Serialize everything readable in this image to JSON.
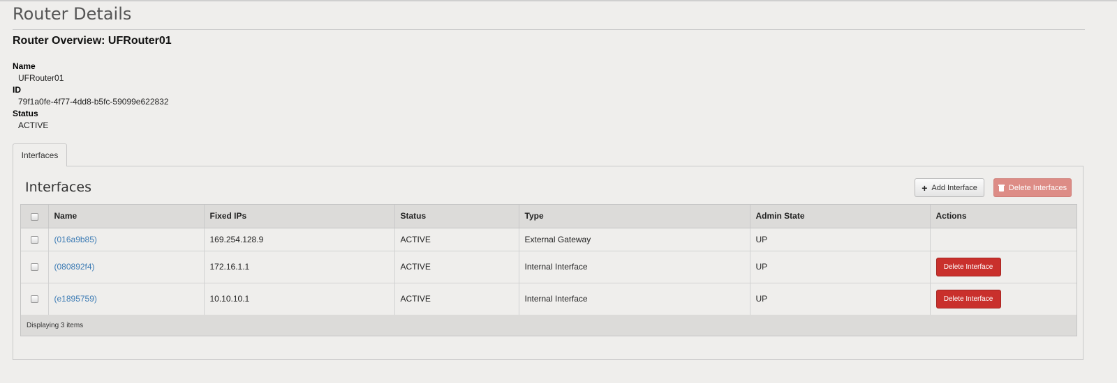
{
  "page": {
    "title": "Router Details"
  },
  "overview": {
    "title": "Router Overview: UFRouter01",
    "fields": [
      {
        "label": "Name",
        "value": "UFRouter01"
      },
      {
        "label": "ID",
        "value": "79f1a0fe-4f77-4dd8-b5fc-59099e622832"
      },
      {
        "label": "Status",
        "value": "ACTIVE"
      }
    ]
  },
  "tabs": [
    {
      "label": "Interfaces",
      "active": true
    }
  ],
  "interfaces": {
    "title": "Interfaces",
    "add_button": "Add Interface",
    "delete_all_button": "Delete Interfaces",
    "columns": [
      "Name",
      "Fixed IPs",
      "Status",
      "Type",
      "Admin State",
      "Actions"
    ],
    "rows": [
      {
        "name": "(016a9b85)",
        "fixed_ips": "169.254.128.9",
        "status": "ACTIVE",
        "type": "External Gateway",
        "admin_state": "UP",
        "action": ""
      },
      {
        "name": "(080892f4)",
        "fixed_ips": "172.16.1.1",
        "status": "ACTIVE",
        "type": "Internal Interface",
        "admin_state": "UP",
        "action": "Delete Interface"
      },
      {
        "name": "(e1895759)",
        "fixed_ips": "10.10.10.1",
        "status": "ACTIVE",
        "type": "Internal Interface",
        "admin_state": "UP",
        "action": "Delete Interface"
      }
    ],
    "footer": "Displaying 3 items"
  },
  "colors": {
    "link": "#3c7bb4",
    "danger": "#c9302c",
    "danger_disabled": "#dd8c86",
    "background": "#efeeec"
  }
}
